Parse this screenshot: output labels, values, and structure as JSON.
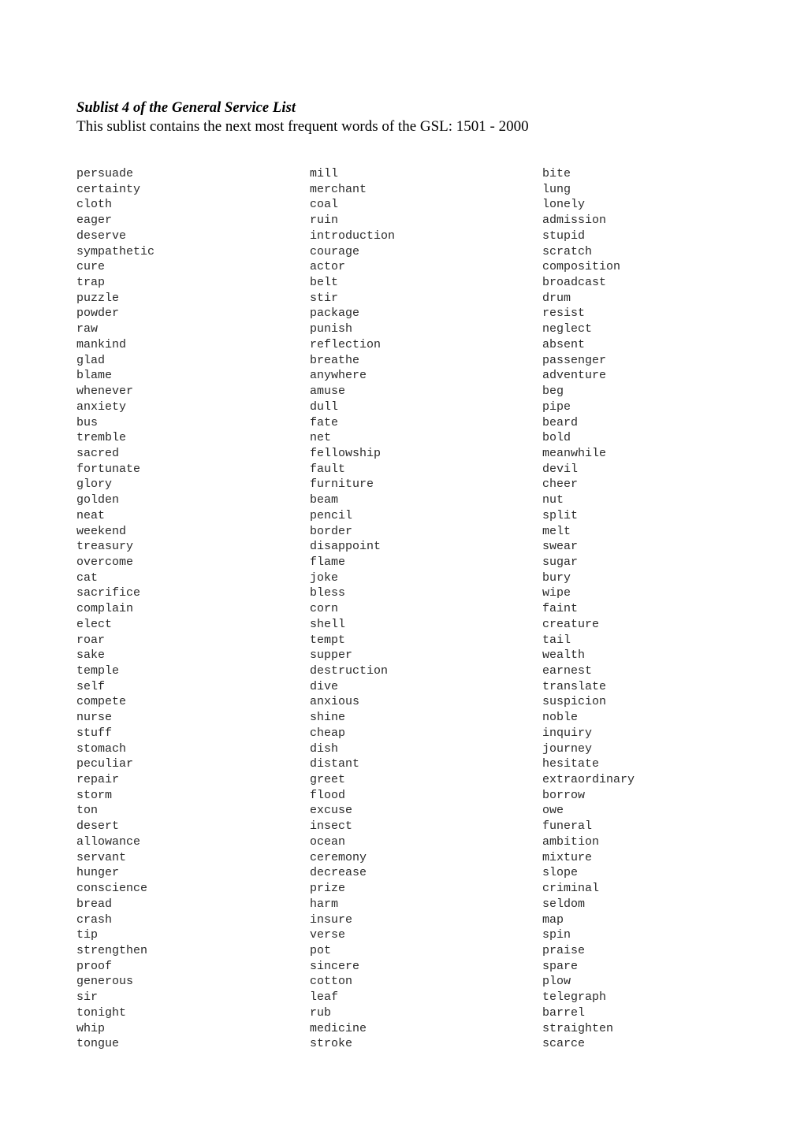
{
  "document": {
    "title": "Sublist 4 of the General Service List",
    "subtitle": "This sublist contains the next most frequent words of the GSL: 1501 - 2000"
  },
  "columns": [
    {
      "name": "column-1",
      "words": [
        "persuade",
        "certainty",
        "cloth",
        "eager",
        "deserve",
        "sympathetic",
        "cure",
        "trap",
        "puzzle",
        "powder",
        "raw",
        "mankind",
        "glad",
        "blame",
        "whenever",
        "anxiety",
        "bus",
        "tremble",
        "sacred",
        "fortunate",
        "glory",
        "golden",
        "neat",
        "weekend",
        "treasury",
        "overcome",
        "cat",
        "sacrifice",
        "complain",
        "elect",
        "roar",
        "sake",
        "temple",
        "self",
        "compete",
        "nurse",
        "stuff",
        "stomach",
        "peculiar",
        "repair",
        "storm",
        "ton",
        "desert",
        "allowance",
        "servant",
        "hunger",
        "conscience",
        "bread",
        "crash",
        "tip",
        "strengthen",
        "proof",
        "generous",
        "sir",
        "tonight",
        "whip",
        "tongue"
      ]
    },
    {
      "name": "column-2",
      "words": [
        "mill",
        "merchant",
        "coal",
        "ruin",
        "introduction",
        "courage",
        "actor",
        "belt",
        "stir",
        "package",
        "punish",
        "reflection",
        "breathe",
        "anywhere",
        "amuse",
        "dull",
        "fate",
        "net",
        "fellowship",
        "fault",
        "furniture",
        "beam",
        "pencil",
        "border",
        "disappoint",
        "flame",
        "joke",
        "bless",
        "corn",
        "shell",
        "tempt",
        "supper",
        "destruction",
        "dive",
        "anxious",
        "shine",
        "cheap",
        "dish",
        "distant",
        "greet",
        "flood",
        "excuse",
        "insect",
        "ocean",
        "ceremony",
        "decrease",
        "prize",
        "harm",
        "insure",
        "verse",
        "pot",
        "sincere",
        "cotton",
        "leaf",
        "rub",
        "medicine",
        "stroke"
      ]
    },
    {
      "name": "column-3",
      "words": [
        "bite",
        "lung",
        "lonely",
        "admission",
        "stupid",
        "scratch",
        "composition",
        "broadcast",
        "drum",
        "resist",
        "neglect",
        "absent",
        "passenger",
        "adventure",
        "beg",
        "pipe",
        "beard",
        "bold",
        "meanwhile",
        "devil",
        "cheer",
        "nut",
        "split",
        "melt",
        "swear",
        "sugar",
        "bury",
        "wipe",
        "faint",
        "creature",
        "tail",
        "wealth",
        "earnest",
        "translate",
        "suspicion",
        "noble",
        "inquiry",
        "journey",
        "hesitate",
        "extraordinary",
        "borrow",
        "owe",
        "funeral",
        "ambition",
        "mixture",
        "slope",
        "criminal",
        "seldom",
        "map",
        "spin",
        "praise",
        "spare",
        "plow",
        "telegraph",
        "barrel",
        "straighten",
        "scarce"
      ]
    }
  ]
}
